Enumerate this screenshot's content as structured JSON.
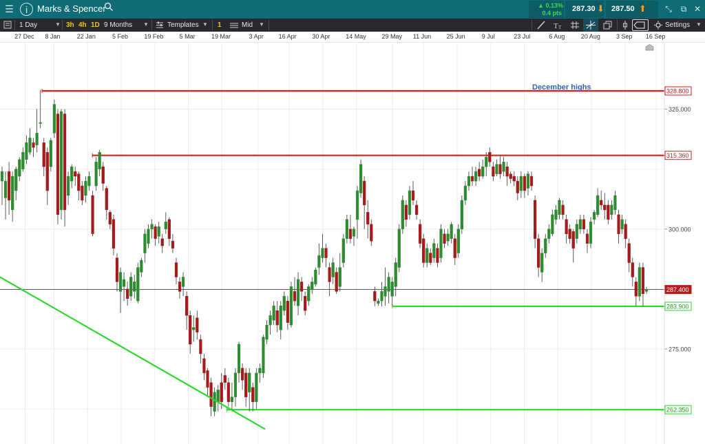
{
  "title_bar": {
    "instrument": "Marks & Spencer",
    "change_pct": "▲ 0.13%",
    "change_pts": "0.4 pts",
    "sell_price": "287.30",
    "buy_price": "287.50"
  },
  "toolbar": {
    "interval": "1 Day",
    "tf_3h": "3h",
    "tf_4h": "4h",
    "tf_1d": "1D",
    "range": "9 Months",
    "templates": "Templates",
    "tag_1": "1",
    "price_mode": "Mid",
    "settings": "Settings"
  },
  "colors": {
    "up": "#2e8b32",
    "down": "#a31b1b",
    "resistance": "#dd1d1d",
    "support": "#2fd62f",
    "annotation": "#2f65b6"
  },
  "chart_data": {
    "type": "candlestick",
    "title": "",
    "x_ticks": [
      "27 Dec",
      "8 Jan",
      "22 Jan",
      "5 Feb",
      "19 Feb",
      "5 Mar",
      "19 Mar",
      "3 Apr",
      "16 Apr",
      "30 Apr",
      "14 May",
      "29 May",
      "11 Jun",
      "25 Jun",
      "9 Jul",
      "23 Jul",
      "6 Aug",
      "20 Aug",
      "3 Sep",
      "16 Sep"
    ],
    "y_ticks": [
      "325.000",
      "300.000",
      "275.000"
    ],
    "ylim": [
      253.2,
      338.0
    ],
    "grid": true,
    "last_price": 287.4,
    "last_price_label": "287.400",
    "horizontal_levels": [
      {
        "value": 328.8,
        "label": "328.800",
        "color": "#dd1d1d",
        "from_date": "3 Jan"
      },
      {
        "value": 315.36,
        "label": "315.360",
        "color": "#dd1d1d",
        "from_date": "24 Jan"
      },
      {
        "value": 283.9,
        "label": "283.900",
        "color": "#2fd62f",
        "from_date": "29 May"
      },
      {
        "value": 262.35,
        "label": "262.350",
        "color": "#2fd62f",
        "from_date": "21 Mar"
      }
    ],
    "trendline": {
      "label": "",
      "color": "#2fd62f",
      "points": [
        {
          "date": "13 Dec",
          "value": 291.0
        },
        {
          "date": "6 Apr",
          "value": 258.3
        }
      ]
    },
    "annotations": [
      "December highs"
    ],
    "series": [
      {
        "o": 310.0,
        "c": 312.0,
        "h": 313.0,
        "l": 305.0
      },
      {
        "o": 306.5,
        "c": 310.0,
        "h": 312.0,
        "l": 302.0
      },
      {
        "o": 312.0,
        "c": 306.0,
        "h": 314.0,
        "l": 303.0
      },
      {
        "o": 304.0,
        "c": 311.0,
        "h": 312.0,
        "l": 301.5
      },
      {
        "o": 308.0,
        "c": 312.5,
        "h": 313.0,
        "l": 306.0
      },
      {
        "o": 311.0,
        "c": 314.5,
        "h": 315.0,
        "l": 310.0
      },
      {
        "o": 312.5,
        "c": 316.0,
        "h": 317.0,
        "l": 312.0
      },
      {
        "o": 314.5,
        "c": 318.0,
        "h": 319.5,
        "l": 313.5
      },
      {
        "o": 316.0,
        "c": 319.0,
        "h": 321.0,
        "l": 315.5
      },
      {
        "o": 318.0,
        "c": 317.0,
        "h": 319.0,
        "l": 315.0
      },
      {
        "o": 317.5,
        "c": 320.0,
        "h": 325.0,
        "l": 316.0
      },
      {
        "o": 322.0,
        "c": 322.2,
        "h": 329.0,
        "l": 321.0
      },
      {
        "o": 318.0,
        "c": 313.0,
        "h": 319.0,
        "l": 311.0
      },
      {
        "o": 316.0,
        "c": 308.0,
        "h": 317.0,
        "l": 305.0
      },
      {
        "o": 313.0,
        "c": 318.5,
        "h": 319.0,
        "l": 312.0
      },
      {
        "o": 320.0,
        "c": 326.0,
        "h": 327.0,
        "l": 319.0
      },
      {
        "o": 324.0,
        "c": 303.0,
        "h": 325.0,
        "l": 301.0
      },
      {
        "o": 304.0,
        "c": 324.5,
        "h": 325.0,
        "l": 302.0
      },
      {
        "o": 324.0,
        "c": 304.0,
        "h": 325.0,
        "l": 300.5
      },
      {
        "o": 307.0,
        "c": 311.0,
        "h": 312.0,
        "l": 305.0
      },
      {
        "o": 310.0,
        "c": 313.0,
        "h": 313.5,
        "l": 308.5
      },
      {
        "o": 312.0,
        "c": 311.0,
        "h": 313.0,
        "l": 309.0
      },
      {
        "o": 311.5,
        "c": 308.0,
        "h": 312.0,
        "l": 306.0
      },
      {
        "o": 309.0,
        "c": 306.0,
        "h": 310.0,
        "l": 305.0
      },
      {
        "o": 307.0,
        "c": 310.0,
        "h": 311.0,
        "l": 305.5
      },
      {
        "o": 309.0,
        "c": 311.0,
        "h": 312.0,
        "l": 308.0
      },
      {
        "o": 307.0,
        "c": 299.0,
        "h": 308.0,
        "l": 298.5
      },
      {
        "o": 309.0,
        "c": 314.0,
        "h": 315.0,
        "l": 308.0
      },
      {
        "o": 312.5,
        "c": 316.0,
        "h": 316.5,
        "l": 311.0
      },
      {
        "o": 313.0,
        "c": 309.5,
        "h": 314.0,
        "l": 308.0
      },
      {
        "o": 308.5,
        "c": 304.0,
        "h": 309.0,
        "l": 302.0
      },
      {
        "o": 303.5,
        "c": 301.0,
        "h": 304.0,
        "l": 300.0
      },
      {
        "o": 302.0,
        "c": 296.0,
        "h": 303.0,
        "l": 294.5
      },
      {
        "o": 294.0,
        "c": 289.0,
        "h": 295.0,
        "l": 287.0
      },
      {
        "o": 287.0,
        "c": 291.0,
        "h": 292.0,
        "l": 282.5
      },
      {
        "o": 288.0,
        "c": 289.5,
        "h": 291.0,
        "l": 285.0
      },
      {
        "o": 287.5,
        "c": 285.5,
        "h": 289.0,
        "l": 284.0
      },
      {
        "o": 286.0,
        "c": 290.0,
        "h": 291.0,
        "l": 285.0
      },
      {
        "o": 287.0,
        "c": 289.0,
        "h": 290.5,
        "l": 285.5
      },
      {
        "o": 285.0,
        "c": 292.0,
        "h": 293.0,
        "l": 284.5
      },
      {
        "o": 291.0,
        "c": 293.5,
        "h": 294.0,
        "l": 290.0
      },
      {
        "o": 295.0,
        "c": 299.0,
        "h": 300.0,
        "l": 293.0
      },
      {
        "o": 297.0,
        "c": 300.0,
        "h": 301.0,
        "l": 296.0
      },
      {
        "o": 300.0,
        "c": 301.0,
        "h": 302.0,
        "l": 298.0
      },
      {
        "o": 300.5,
        "c": 298.0,
        "h": 301.0,
        "l": 296.5
      },
      {
        "o": 298.5,
        "c": 300.5,
        "h": 301.5,
        "l": 297.0
      },
      {
        "o": 298.0,
        "c": 296.5,
        "h": 299.0,
        "l": 295.0
      },
      {
        "o": 300.0,
        "c": 301.5,
        "h": 303.5,
        "l": 299.0
      },
      {
        "o": 302.0,
        "c": 298.0,
        "h": 302.5,
        "l": 296.5
      },
      {
        "o": 297.5,
        "c": 296.0,
        "h": 299.0,
        "l": 295.0
      },
      {
        "o": 293.0,
        "c": 290.0,
        "h": 294.0,
        "l": 288.5
      },
      {
        "o": 289.0,
        "c": 287.0,
        "h": 290.0,
        "l": 285.5
      },
      {
        "o": 288.0,
        "c": 290.0,
        "h": 291.0,
        "l": 286.0
      },
      {
        "o": 286.0,
        "c": 282.0,
        "h": 287.0,
        "l": 279.0
      },
      {
        "o": 282.0,
        "c": 276.0,
        "h": 283.0,
        "l": 274.0
      },
      {
        "o": 279.0,
        "c": 279.5,
        "h": 282.0,
        "l": 276.5
      },
      {
        "o": 281.5,
        "c": 278.5,
        "h": 283.0,
        "l": 277.0
      },
      {
        "o": 277.0,
        "c": 274.0,
        "h": 278.0,
        "l": 272.0
      },
      {
        "o": 273.0,
        "c": 270.0,
        "h": 274.0,
        "l": 268.5
      },
      {
        "o": 270.5,
        "c": 267.0,
        "h": 271.0,
        "l": 265.0
      },
      {
        "o": 268.0,
        "c": 263.0,
        "h": 269.0,
        "l": 261.0
      },
      {
        "o": 262.0,
        "c": 266.0,
        "h": 267.0,
        "l": 261.0
      },
      {
        "o": 264.0,
        "c": 266.5,
        "h": 267.5,
        "l": 262.0
      },
      {
        "o": 268.0,
        "c": 264.0,
        "h": 270.0,
        "l": 262.5
      },
      {
        "o": 269.5,
        "c": 268.0,
        "h": 271.0,
        "l": 266.5
      },
      {
        "o": 268.0,
        "c": 264.0,
        "h": 269.0,
        "l": 263.0
      },
      {
        "o": 264.0,
        "c": 265.0,
        "h": 268.0,
        "l": 262.0
      },
      {
        "o": 265.0,
        "c": 270.0,
        "h": 271.0,
        "l": 263.0
      },
      {
        "o": 270.0,
        "c": 276.0,
        "h": 276.5,
        "l": 268.0
      },
      {
        "o": 271.0,
        "c": 268.5,
        "h": 272.0,
        "l": 266.5
      },
      {
        "o": 270.0,
        "c": 265.0,
        "h": 271.0,
        "l": 263.0
      },
      {
        "o": 266.0,
        "c": 270.0,
        "h": 271.0,
        "l": 262.0
      },
      {
        "o": 267.0,
        "c": 264.0,
        "h": 268.0,
        "l": 262.0
      },
      {
        "o": 264.0,
        "c": 270.0,
        "h": 271.0,
        "l": 262.5
      },
      {
        "o": 270.0,
        "c": 271.0,
        "h": 272.0,
        "l": 268.0
      },
      {
        "o": 270.0,
        "c": 277.5,
        "h": 278.0,
        "l": 269.0
      },
      {
        "o": 277.0,
        "c": 280.0,
        "h": 281.0,
        "l": 276.0
      },
      {
        "o": 280.0,
        "c": 282.0,
        "h": 283.0,
        "l": 278.0
      },
      {
        "o": 281.0,
        "c": 284.0,
        "h": 285.0,
        "l": 280.0
      },
      {
        "o": 283.0,
        "c": 280.0,
        "h": 285.0,
        "l": 278.5
      },
      {
        "o": 279.0,
        "c": 284.0,
        "h": 285.0,
        "l": 277.0
      },
      {
        "o": 283.0,
        "c": 286.0,
        "h": 287.0,
        "l": 282.0
      },
      {
        "o": 285.0,
        "c": 280.5,
        "h": 286.0,
        "l": 279.0
      },
      {
        "o": 280.0,
        "c": 288.0,
        "h": 289.0,
        "l": 279.5
      },
      {
        "o": 287.0,
        "c": 285.0,
        "h": 290.0,
        "l": 284.0
      },
      {
        "o": 284.0,
        "c": 289.5,
        "h": 291.0,
        "l": 282.0
      },
      {
        "o": 289.0,
        "c": 287.0,
        "h": 290.0,
        "l": 285.0
      },
      {
        "o": 286.0,
        "c": 283.0,
        "h": 287.0,
        "l": 282.0
      },
      {
        "o": 285.0,
        "c": 288.0,
        "h": 288.5,
        "l": 284.0
      },
      {
        "o": 287.5,
        "c": 289.0,
        "h": 290.0,
        "l": 286.5
      },
      {
        "o": 288.5,
        "c": 291.5,
        "h": 292.0,
        "l": 288.0
      },
      {
        "o": 292.0,
        "c": 294.5,
        "h": 297.0,
        "l": 290.5
      },
      {
        "o": 294.0,
        "c": 296.0,
        "h": 299.0,
        "l": 293.0
      },
      {
        "o": 296.0,
        "c": 294.0,
        "h": 297.0,
        "l": 292.0
      },
      {
        "o": 292.0,
        "c": 289.0,
        "h": 293.0,
        "l": 286.0
      },
      {
        "o": 290.0,
        "c": 293.0,
        "h": 294.0,
        "l": 288.5
      },
      {
        "o": 291.0,
        "c": 287.0,
        "h": 292.0,
        "l": 286.5
      },
      {
        "o": 288.0,
        "c": 292.0,
        "h": 295.0,
        "l": 287.0
      },
      {
        "o": 293.0,
        "c": 298.0,
        "h": 299.0,
        "l": 292.0
      },
      {
        "o": 298.0,
        "c": 302.0,
        "h": 303.0,
        "l": 297.0
      },
      {
        "o": 300.0,
        "c": 298.0,
        "h": 303.0,
        "l": 297.0
      },
      {
        "o": 298.5,
        "c": 300.0,
        "h": 300.5,
        "l": 296.5
      },
      {
        "o": 302.0,
        "c": 308.0,
        "h": 309.0,
        "l": 298.0
      },
      {
        "o": 307.5,
        "c": 313.5,
        "h": 314.5,
        "l": 306.5
      },
      {
        "o": 310.0,
        "c": 305.0,
        "h": 311.0,
        "l": 300.0
      },
      {
        "o": 303.5,
        "c": 301.0,
        "h": 306.0,
        "l": 298.0
      },
      {
        "o": 301.0,
        "c": 297.5,
        "h": 302.0,
        "l": 296.5
      },
      {
        "o": 287.0,
        "c": 285.0,
        "h": 288.0,
        "l": 283.9
      },
      {
        "o": 284.5,
        "c": 285.0,
        "h": 285.5,
        "l": 284.0
      },
      {
        "o": 285.0,
        "c": 287.0,
        "h": 289.0,
        "l": 283.9
      },
      {
        "o": 286.0,
        "c": 288.0,
        "h": 292.0,
        "l": 284.0
      },
      {
        "o": 287.0,
        "c": 290.0,
        "h": 291.0,
        "l": 284.5
      },
      {
        "o": 286.0,
        "c": 289.0,
        "h": 290.0,
        "l": 284.0
      },
      {
        "o": 288.0,
        "c": 293.0,
        "h": 294.0,
        "l": 286.0
      },
      {
        "o": 292.0,
        "c": 300.0,
        "h": 301.0,
        "l": 291.0
      },
      {
        "o": 300.0,
        "c": 306.0,
        "h": 307.0,
        "l": 299.0
      },
      {
        "o": 305.0,
        "c": 302.0,
        "h": 306.0,
        "l": 300.5
      },
      {
        "o": 303.0,
        "c": 308.0,
        "h": 309.0,
        "l": 302.0
      },
      {
        "o": 308.0,
        "c": 306.0,
        "h": 310.0,
        "l": 305.0
      },
      {
        "o": 305.0,
        "c": 303.0,
        "h": 306.0,
        "l": 302.0
      },
      {
        "o": 301.0,
        "c": 297.0,
        "h": 302.0,
        "l": 296.0
      },
      {
        "o": 298.0,
        "c": 293.0,
        "h": 299.0,
        "l": 292.0
      },
      {
        "o": 293.0,
        "c": 296.0,
        "h": 297.0,
        "l": 292.0
      },
      {
        "o": 295.0,
        "c": 293.0,
        "h": 296.0,
        "l": 292.5
      },
      {
        "o": 294.0,
        "c": 297.0,
        "h": 298.0,
        "l": 293.0
      },
      {
        "o": 296.0,
        "c": 293.0,
        "h": 297.0,
        "l": 292.0
      },
      {
        "o": 294.0,
        "c": 300.0,
        "h": 301.0,
        "l": 293.0
      },
      {
        "o": 299.0,
        "c": 297.0,
        "h": 300.0,
        "l": 296.0
      },
      {
        "o": 297.5,
        "c": 299.0,
        "h": 300.0,
        "l": 296.5
      },
      {
        "o": 298.0,
        "c": 301.0,
        "h": 301.5,
        "l": 297.0
      },
      {
        "o": 298.0,
        "c": 294.0,
        "h": 299.0,
        "l": 292.5
      },
      {
        "o": 295.0,
        "c": 300.0,
        "h": 301.0,
        "l": 294.0
      },
      {
        "o": 300.0,
        "c": 306.0,
        "h": 307.0,
        "l": 299.0
      },
      {
        "o": 306.0,
        "c": 309.0,
        "h": 310.0,
        "l": 305.0
      },
      {
        "o": 309.0,
        "c": 311.0,
        "h": 312.0,
        "l": 308.0
      },
      {
        "o": 311.0,
        "c": 310.0,
        "h": 313.0,
        "l": 309.0
      },
      {
        "o": 310.0,
        "c": 312.0,
        "h": 313.0,
        "l": 309.0
      },
      {
        "o": 312.5,
        "c": 311.0,
        "h": 314.0,
        "l": 310.0
      },
      {
        "o": 311.0,
        "c": 313.0,
        "h": 314.5,
        "l": 310.5
      },
      {
        "o": 313.0,
        "c": 315.0,
        "h": 316.0,
        "l": 311.0
      },
      {
        "o": 316.0,
        "c": 314.0,
        "h": 317.0,
        "l": 313.0
      },
      {
        "o": 313.0,
        "c": 311.0,
        "h": 314.0,
        "l": 310.0
      },
      {
        "o": 311.5,
        "c": 313.5,
        "h": 314.5,
        "l": 311.0
      },
      {
        "o": 313.5,
        "c": 311.5,
        "h": 315.5,
        "l": 310.5
      },
      {
        "o": 312.0,
        "c": 314.0,
        "h": 315.0,
        "l": 311.0
      },
      {
        "o": 313.0,
        "c": 311.0,
        "h": 314.0,
        "l": 309.0
      },
      {
        "o": 311.5,
        "c": 310.5,
        "h": 312.0,
        "l": 309.5
      },
      {
        "o": 311.0,
        "c": 310.0,
        "h": 312.0,
        "l": 309.0
      },
      {
        "o": 310.0,
        "c": 307.5,
        "h": 311.0,
        "l": 306.0
      },
      {
        "o": 308.0,
        "c": 311.0,
        "h": 312.0,
        "l": 306.5
      },
      {
        "o": 311.0,
        "c": 308.0,
        "h": 311.5,
        "l": 306.5
      },
      {
        "o": 308.5,
        "c": 311.5,
        "h": 312.0,
        "l": 307.0
      },
      {
        "o": 311.0,
        "c": 309.0,
        "h": 312.0,
        "l": 308.0
      },
      {
        "o": 306.0,
        "c": 298.0,
        "h": 307.0,
        "l": 296.0
      },
      {
        "o": 298.0,
        "c": 292.0,
        "h": 299.0,
        "l": 290.0
      },
      {
        "o": 291.0,
        "c": 295.0,
        "h": 296.0,
        "l": 289.0
      },
      {
        "o": 295.0,
        "c": 298.0,
        "h": 299.0,
        "l": 294.0
      },
      {
        "o": 298.0,
        "c": 300.0,
        "h": 301.0,
        "l": 297.0
      },
      {
        "o": 299.0,
        "c": 303.0,
        "h": 304.0,
        "l": 298.5
      },
      {
        "o": 302.0,
        "c": 304.0,
        "h": 305.0,
        "l": 301.0
      },
      {
        "o": 303.0,
        "c": 306.0,
        "h": 306.5,
        "l": 302.0
      },
      {
        "o": 305.0,
        "c": 303.0,
        "h": 306.0,
        "l": 302.0
      },
      {
        "o": 302.0,
        "c": 299.0,
        "h": 303.0,
        "l": 297.0
      },
      {
        "o": 300.0,
        "c": 298.0,
        "h": 301.0,
        "l": 297.0
      },
      {
        "o": 299.5,
        "c": 296.0,
        "h": 300.0,
        "l": 293.0
      },
      {
        "o": 298.0,
        "c": 301.0,
        "h": 302.0,
        "l": 297.0
      },
      {
        "o": 300.0,
        "c": 302.0,
        "h": 303.0,
        "l": 299.0
      },
      {
        "o": 302.0,
        "c": 300.0,
        "h": 303.0,
        "l": 299.0
      },
      {
        "o": 299.0,
        "c": 297.0,
        "h": 300.0,
        "l": 295.0
      },
      {
        "o": 297.0,
        "c": 301.5,
        "h": 302.5,
        "l": 296.0
      },
      {
        "o": 302.0,
        "c": 303.5,
        "h": 304.0,
        "l": 301.0
      },
      {
        "o": 303.0,
        "c": 307.0,
        "h": 308.5,
        "l": 302.5
      },
      {
        "o": 306.0,
        "c": 305.0,
        "h": 308.0,
        "l": 304.0
      },
      {
        "o": 305.0,
        "c": 304.0,
        "h": 307.5,
        "l": 302.0
      },
      {
        "o": 305.0,
        "c": 302.0,
        "h": 306.0,
        "l": 301.0
      },
      {
        "o": 303.0,
        "c": 305.0,
        "h": 306.0,
        "l": 302.0
      },
      {
        "o": 304.0,
        "c": 307.0,
        "h": 308.0,
        "l": 303.0
      },
      {
        "o": 303.0,
        "c": 299.0,
        "h": 304.0,
        "l": 297.0
      },
      {
        "o": 300.0,
        "c": 302.0,
        "h": 303.0,
        "l": 299.0
      },
      {
        "o": 301.0,
        "c": 298.0,
        "h": 302.0,
        "l": 296.0
      },
      {
        "o": 297.0,
        "c": 293.0,
        "h": 298.0,
        "l": 291.0
      },
      {
        "o": 293.0,
        "c": 290.0,
        "h": 294.0,
        "l": 288.0
      },
      {
        "o": 289.0,
        "c": 286.0,
        "h": 290.0,
        "l": 284.0
      },
      {
        "o": 286.0,
        "c": 292.0,
        "h": 293.0,
        "l": 285.0
      },
      {
        "o": 292.0,
        "c": 286.5,
        "h": 293.0,
        "l": 283.9
      },
      {
        "o": 287.0,
        "c": 287.4,
        "h": 288.0,
        "l": 286.5
      }
    ]
  }
}
